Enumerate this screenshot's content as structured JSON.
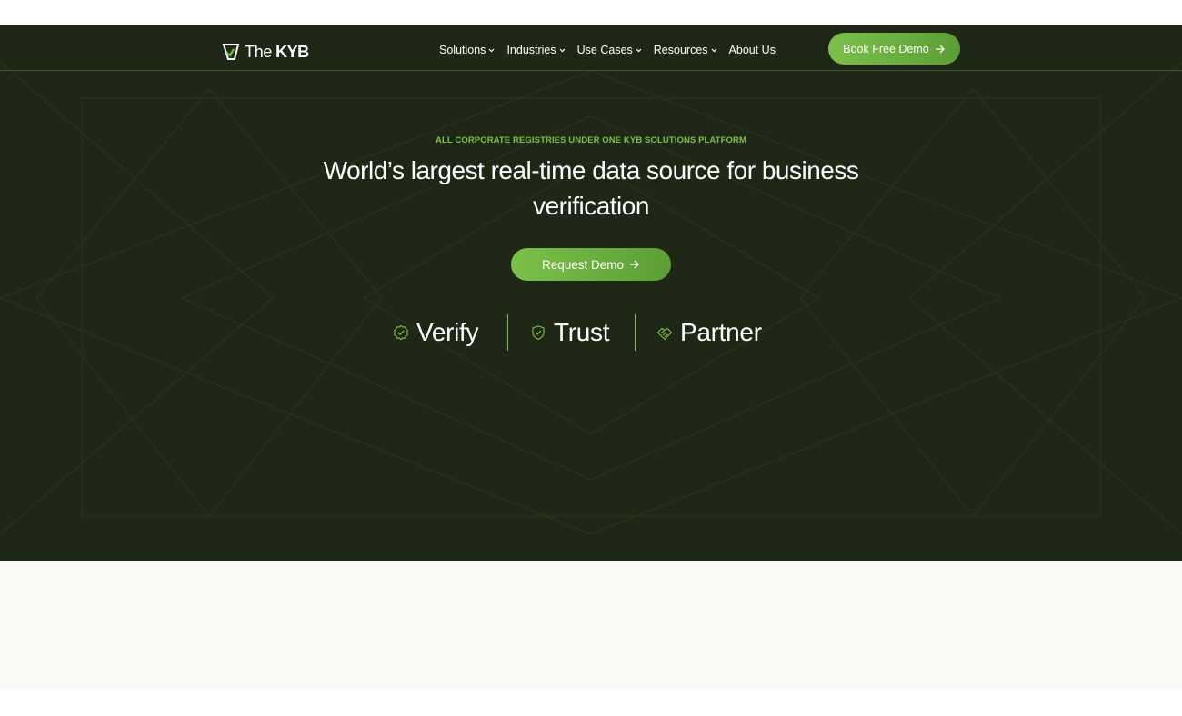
{
  "brand": {
    "logo_prefix": "The",
    "logo_name": "KYB"
  },
  "nav": {
    "items": [
      {
        "label": "Solutions",
        "has_dropdown": true
      },
      {
        "label": "Industries",
        "has_dropdown": true
      },
      {
        "label": "Use Cases",
        "has_dropdown": true
      },
      {
        "label": "Resources",
        "has_dropdown": true
      },
      {
        "label": "About Us",
        "has_dropdown": false
      }
    ],
    "cta_label": "Book Free Demo"
  },
  "hero": {
    "eyebrow": "ALL CORPORATE REGISTRIES UNDER ONE KYB SOLUTIONS PLATFORM",
    "headline": "World’s largest real-time data source for business verification",
    "cta_label": "Request Demo",
    "values": [
      {
        "label": "Verify",
        "icon": "badge-check-icon"
      },
      {
        "label": "Trust",
        "icon": "shield-check-icon"
      },
      {
        "label": "Partner",
        "icon": "handshake-icon"
      }
    ]
  },
  "colors": {
    "hero_bg": "#1f2816",
    "accent": "#7cc04a",
    "accent_dark": "#5c9e35",
    "text": "#ffffff",
    "section_bg": "#f9faf5"
  }
}
